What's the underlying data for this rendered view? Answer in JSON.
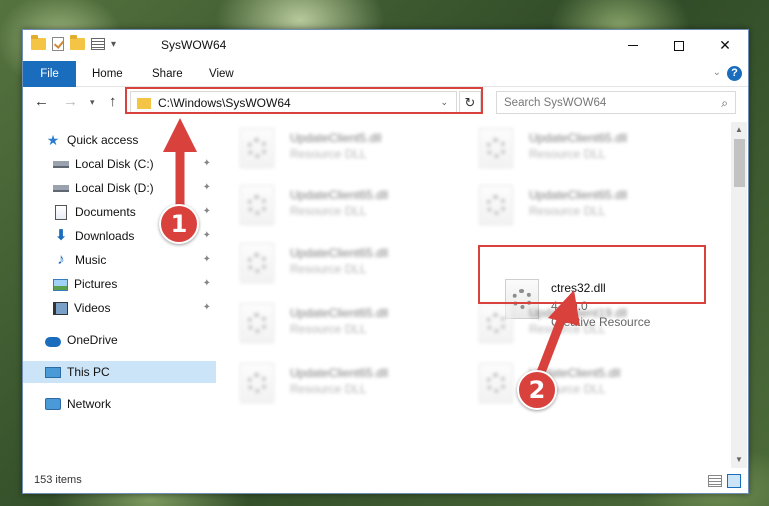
{
  "window": {
    "title": "SysWOW64",
    "minimize_label": "—",
    "maximize_label": "☐",
    "close_label": "✕"
  },
  "ribbon": {
    "tabs": [
      {
        "label": "File"
      },
      {
        "label": "Home"
      },
      {
        "label": "Share"
      },
      {
        "label": "View"
      }
    ],
    "help_label": "?"
  },
  "navbar": {
    "address": "C:\\Windows\\SysWOW64",
    "search_placeholder": "Search SysWOW64"
  },
  "navpane": {
    "items": [
      {
        "label": "Quick access",
        "icon": "star-icon"
      },
      {
        "label": "Local Disk (C:)",
        "icon": "disk-icon"
      },
      {
        "label": "Local Disk (D:)",
        "icon": "disk-icon"
      },
      {
        "label": "Documents",
        "icon": "documents-icon"
      },
      {
        "label": "Downloads",
        "icon": "downloads-icon"
      },
      {
        "label": "Music",
        "icon": "music-icon"
      },
      {
        "label": "Pictures",
        "icon": "pictures-icon"
      },
      {
        "label": "Videos",
        "icon": "videos-icon"
      },
      {
        "label": "OneDrive",
        "icon": "onedrive-icon"
      },
      {
        "label": "This PC",
        "icon": "pc-icon"
      },
      {
        "label": "Network",
        "icon": "network-icon"
      }
    ]
  },
  "files": [
    {
      "name": "UpdateClient5.dll",
      "type": "Resource DLL"
    },
    {
      "name": "UpdateClient65.dll",
      "type": "Resource DLL"
    },
    {
      "name": "UpdateClient65.dll",
      "type": "Resource DLL"
    },
    {
      "name": "UpdateClient65.dll",
      "type": "Resource DLL"
    },
    {
      "name": "UpdateClient65.dll",
      "type": "Resource DLL"
    },
    {
      "name": "UpdateClient65.dll",
      "type": "Resource DLL"
    },
    {
      "name": "UpdateClient19.dll",
      "type": "Resource DLL"
    },
    {
      "name": "UpdateClient65.dll",
      "type": "Resource DLL"
    },
    {
      "name": "UpdateClient5.dll",
      "type": "Resource DLL"
    }
  ],
  "target_file": {
    "name": "ctres32.dll",
    "version": "4.6.0.0",
    "company": "Creative Resource"
  },
  "status": {
    "count": "153 items"
  },
  "callouts": {
    "one": "1",
    "two": "2"
  },
  "colors": {
    "accent": "#1a6dbd",
    "highlight": "#d9413d",
    "selected": "#cce4f7"
  }
}
